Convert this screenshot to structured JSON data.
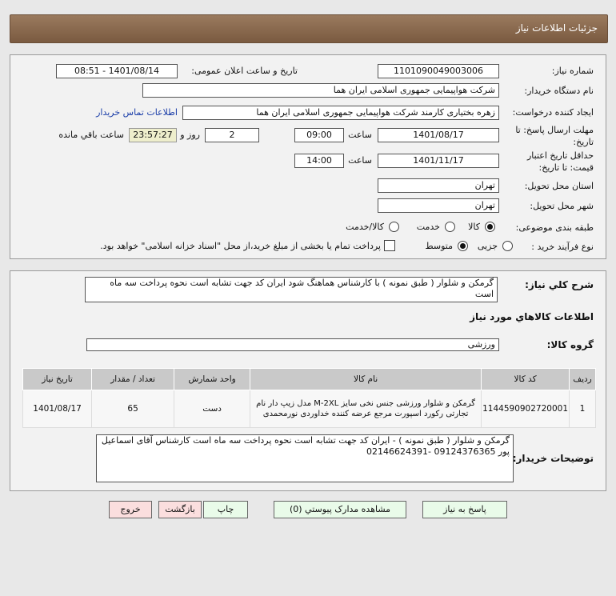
{
  "header": {
    "title": "جزئیات اطلاعات نیاز"
  },
  "fields": {
    "need_number_label": "شماره نیاز:",
    "need_number": "1101090049003006",
    "announce_label": "تاریخ و ساعت اعلان عمومی:",
    "announce_value": "1401/08/14 - 08:51",
    "buyer_org_label": "نام دستگاه خریدار:",
    "buyer_org": "شرکت هواپیمایی جمهوری اسلامی ایران هما",
    "creator_label": "ایجاد کننده درخواست:",
    "creator": "زهره بختیاری کارمند شرکت هواپیمایی جمهوری اسلامی ایران هما",
    "contact_link": "اطلاعات تماس خریدار",
    "deadline_label_1": "مهلت ارسال پاسخ: تا",
    "deadline_label_2": "تاریخ:",
    "deadline_date": "1401/08/17",
    "time_label": "ساعت",
    "deadline_time": "09:00",
    "days": "2",
    "days_label": "روز و",
    "remaining": "23:57:27",
    "remaining_label": "ساعت باقي مانده",
    "validity_label_1": "حداقل تاریخ اعتبار",
    "validity_label_2": "قیمت: تا تاریخ:",
    "validity_date": "1401/11/17",
    "validity_time": "14:00",
    "province_label": "استان محل تحویل:",
    "province": "تهران",
    "city_label": "شهر محل تحویل:",
    "city": "تهران",
    "category_label": "طبقه بندی موضوعی:",
    "category_options": [
      "کالا",
      "خدمت",
      "کالا/خدمت"
    ],
    "category_selected": "کالا",
    "process_label": "نوع فرآیند خرید :",
    "process_options": [
      "جزیی",
      "متوسط"
    ],
    "process_selected": "متوسط",
    "payment_note": "پرداخت تمام یا بخشی از مبلغ خرید،از محل \"اسناد خزانه اسلامی\" خواهد بود.",
    "payment_checked": false
  },
  "details": {
    "description_label": "شرح کلي نیاز:",
    "description": "گرمکن و شلوار  ( طبق نمونه ) با کارشناس هماهنگ شود  ایران کد جهت تشابه است نحوه پرداخت سه  ماه است",
    "goods_title": "اطلاعات کالاهاي مورد نیاز",
    "group_label": "گروه کالا:",
    "group": "ورزشی",
    "table": {
      "headers": [
        "ردیف",
        "کد کالا",
        "نام کالا",
        "واحد شمارش",
        "تعداد / مقدار",
        "تاریخ نیاز"
      ],
      "rows": [
        [
          "1",
          "1144590902720001",
          "گرمکن و شلوار ورزشی جنس نخی سایز M-2XL مدل زیپ دار نام تجارتی رکورد اسپورت مرجع عرضه کننده خداوردی نورمحمدی",
          "دست",
          "65",
          "1401/08/17"
        ]
      ]
    },
    "notes_label": "توضیحات خریدار:",
    "notes": "گرمکن و شلوار  ( طبق نمونه ) - ایران کد جهت تشابه است نحوه پرداخت سه  ماه است کارشناس آقای اسماعیل پور 09124376365 -02146624391"
  },
  "buttons": {
    "reply": "پاسخ به نیاز",
    "attachments": "مشاهده مدارک پیوستي (0)",
    "print": "چاپ",
    "back": "بازگشت",
    "exit": "خروج"
  }
}
